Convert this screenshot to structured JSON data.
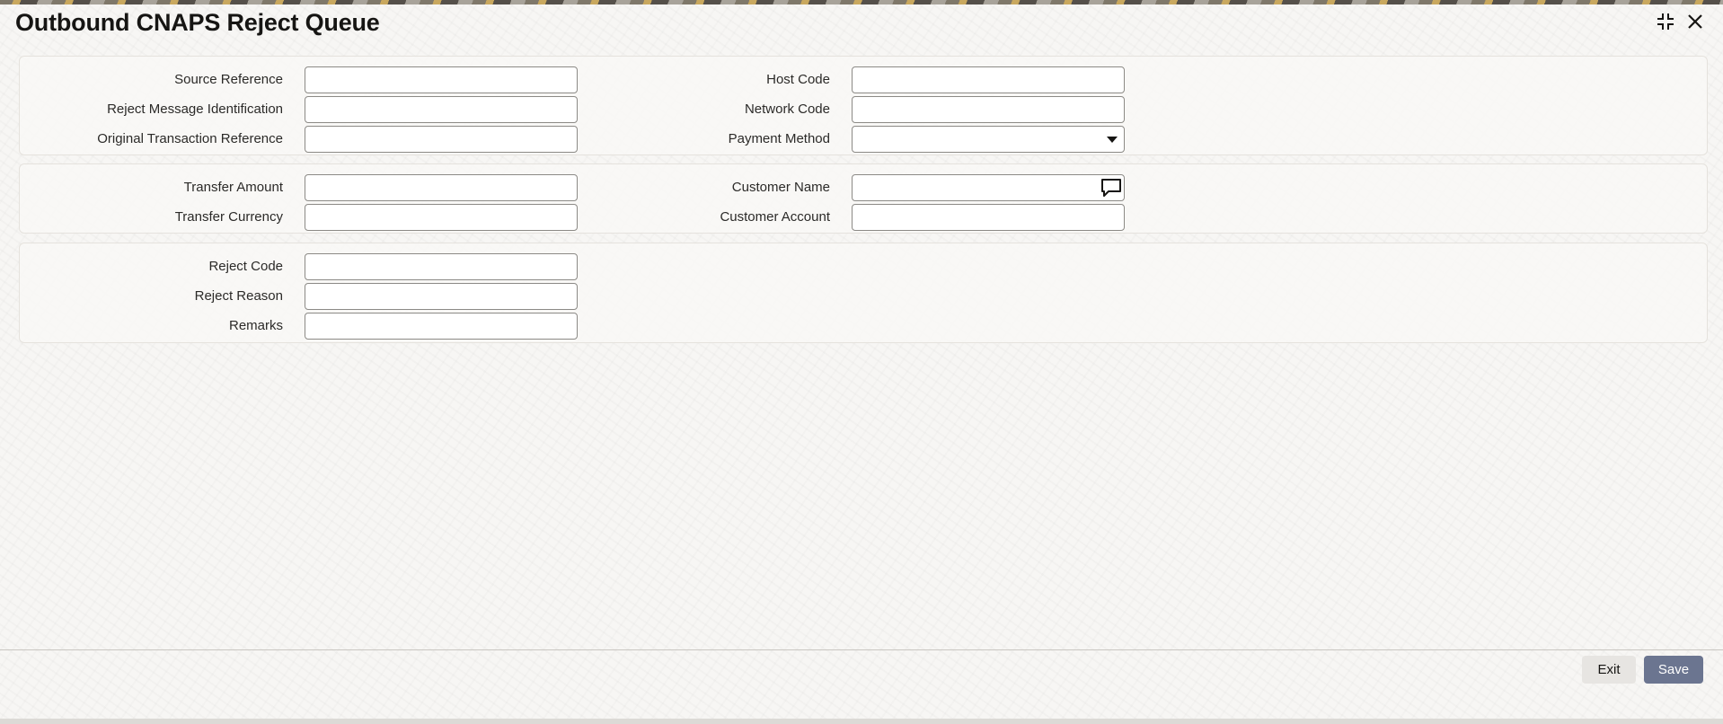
{
  "window": {
    "title": "Outbound CNAPS Reject Queue",
    "maximize_icon": "maximize-icon",
    "close_icon": "close-icon"
  },
  "section1": {
    "source_reference": {
      "label": "Source Reference",
      "value": ""
    },
    "reject_message_identification": {
      "label": "Reject Message Identification",
      "value": ""
    },
    "original_transaction_reference": {
      "label": "Original Transaction Reference",
      "value": ""
    },
    "host_code": {
      "label": "Host Code",
      "value": ""
    },
    "network_code": {
      "label": "Network Code",
      "value": ""
    },
    "payment_method": {
      "label": "Payment Method",
      "value": ""
    }
  },
  "section2": {
    "transfer_amount": {
      "label": "Transfer Amount",
      "value": ""
    },
    "transfer_currency": {
      "label": "Transfer Currency",
      "value": ""
    },
    "customer_name": {
      "label": "Customer Name",
      "value": "",
      "icon": "message-bubble-icon"
    },
    "customer_account": {
      "label": "Customer Account",
      "value": ""
    }
  },
  "section3": {
    "reject_code": {
      "label": "Reject Code",
      "value": ""
    },
    "reject_reason": {
      "label": "Reject Reason",
      "value": ""
    },
    "remarks": {
      "label": "Remarks",
      "value": ""
    }
  },
  "footer": {
    "exit_label": "Exit",
    "save_label": "Save"
  },
  "colors": {
    "save_button": "#6b7590",
    "exit_button": "#e7e5e2",
    "input_border": "#8c8a86"
  }
}
